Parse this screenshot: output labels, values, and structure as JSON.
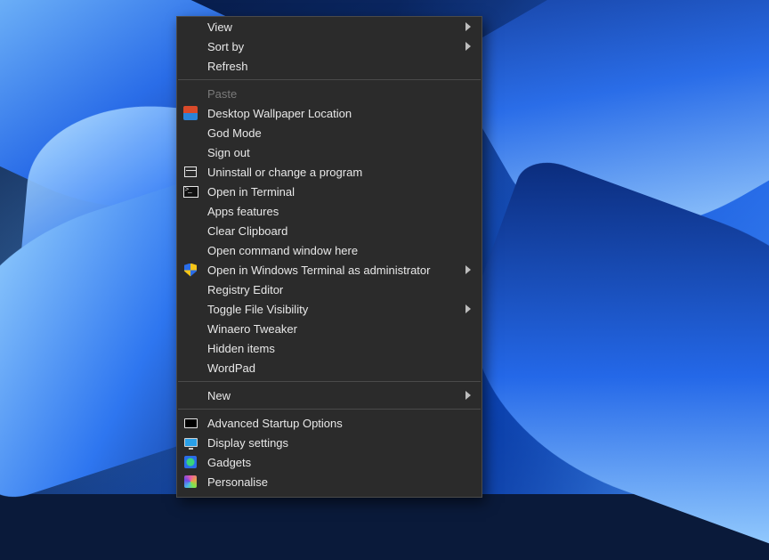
{
  "menu": {
    "section1": [
      {
        "label": "View",
        "submenu": true
      },
      {
        "label": "Sort by",
        "submenu": true
      },
      {
        "label": "Refresh"
      }
    ],
    "section2": [
      {
        "label": "Paste",
        "disabled": true
      },
      {
        "label": "Desktop Wallpaper Location",
        "icon": "wallpaper-icon"
      },
      {
        "label": "God Mode"
      },
      {
        "label": "Sign out"
      },
      {
        "label": "Uninstall or change a program",
        "icon": "programs-icon"
      },
      {
        "label": "Open in Terminal",
        "icon": "terminal-icon"
      },
      {
        "label": "Apps  features"
      },
      {
        "label": "Clear Clipboard"
      },
      {
        "label": "Open command window here"
      },
      {
        "label": "Open in Windows Terminal as administrator",
        "icon": "shield-icon",
        "submenu": true
      },
      {
        "label": "Registry Editor"
      },
      {
        "label": "Toggle File Visibility",
        "submenu": true
      },
      {
        "label": "Winaero Tweaker"
      },
      {
        "label": "Hidden items"
      },
      {
        "label": "WordPad"
      }
    ],
    "section3": [
      {
        "label": "New",
        "submenu": true
      }
    ],
    "section4": [
      {
        "label": "Advanced Startup Options",
        "icon": "startup-icon"
      },
      {
        "label": "Display settings",
        "icon": "display-icon"
      },
      {
        "label": "Gadgets",
        "icon": "gadgets-icon"
      },
      {
        "label": "Personalise",
        "icon": "personalise-icon"
      }
    ]
  }
}
